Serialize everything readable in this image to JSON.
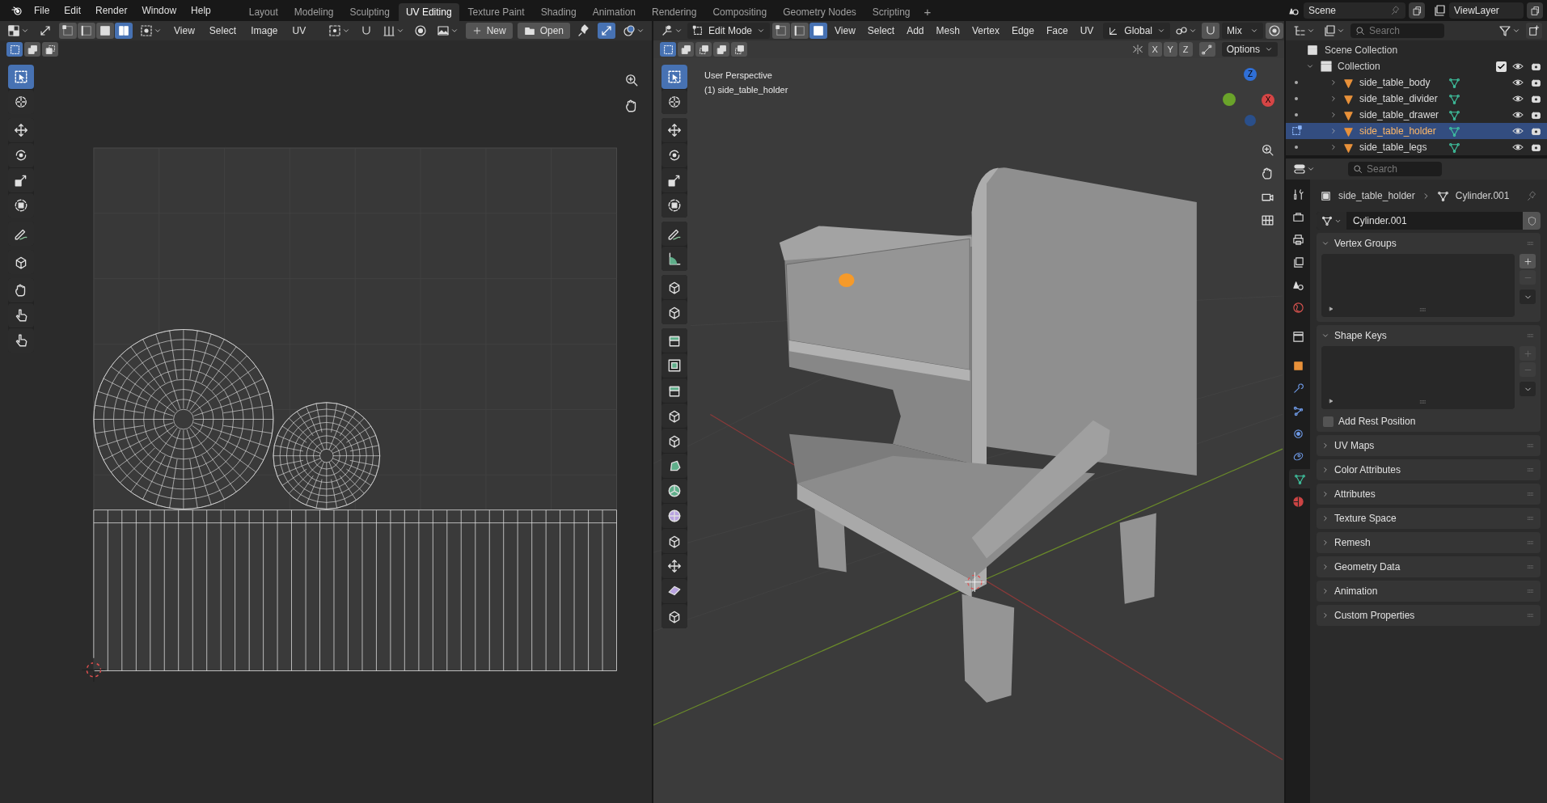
{
  "top_bar": {
    "menus": [
      "File",
      "Edit",
      "Render",
      "Window",
      "Help"
    ],
    "workspaces": [
      {
        "label": "Layout",
        "selected": false
      },
      {
        "label": "Modeling",
        "selected": false
      },
      {
        "label": "Sculpting",
        "selected": false
      },
      {
        "label": "UV Editing",
        "selected": true
      },
      {
        "label": "Texture Paint",
        "selected": false
      },
      {
        "label": "Shading",
        "selected": false
      },
      {
        "label": "Animation",
        "selected": false
      },
      {
        "label": "Rendering",
        "selected": false
      },
      {
        "label": "Compositing",
        "selected": false
      },
      {
        "label": "Geometry Nodes",
        "selected": false
      },
      {
        "label": "Scripting",
        "selected": false
      }
    ],
    "add_tab": "+",
    "scene": "Scene",
    "view_layer": "ViewLayer"
  },
  "uv_editor": {
    "select_modes": [
      {
        "kind": "vertex",
        "selected": false
      },
      {
        "kind": "edge",
        "selected": false
      },
      {
        "kind": "face",
        "selected": false
      },
      {
        "kind": "island",
        "selected": true
      }
    ],
    "menus": [
      "View",
      "Select",
      "Image",
      "UV"
    ],
    "new_button": "New",
    "open_button": "Open"
  },
  "viewport": {
    "mode": "Edit Mode",
    "select_modes": [
      {
        "kind": "vertex",
        "selected": false
      },
      {
        "kind": "edge",
        "selected": false
      },
      {
        "kind": "face",
        "selected": true
      }
    ],
    "menus": [
      "View",
      "Select",
      "Add",
      "Mesh",
      "Vertex",
      "Edge",
      "Face",
      "UV"
    ],
    "orientation": "Global",
    "falloff": "Mix",
    "axes": [
      "X",
      "Y",
      "Z"
    ],
    "options": "Options",
    "overlay_lines": [
      "User Perspective",
      "(1) side_table_holder"
    ],
    "gizmo_labels": [
      "Z",
      "X"
    ]
  },
  "outliner": {
    "search_placeholder": "Search",
    "scene_collection": "Scene Collection",
    "collection": {
      "name": "Collection",
      "expanded": true,
      "checked": true
    },
    "objects": [
      {
        "name": "side_table_body",
        "selected": false
      },
      {
        "name": "side_table_divider",
        "selected": false
      },
      {
        "name": "side_table_drawer",
        "selected": false
      },
      {
        "name": "side_table_holder",
        "selected": true
      },
      {
        "name": "side_table_legs",
        "selected": false
      }
    ]
  },
  "properties": {
    "search_placeholder": "Search",
    "object_name": "side_table_holder",
    "data_name": "Cylinder.001",
    "mesh_field": "Cylinder.001",
    "tabs": [
      {
        "kind": "tool",
        "selected": false
      },
      {
        "kind": "render",
        "selected": false
      },
      {
        "kind": "output",
        "selected": false
      },
      {
        "kind": "view_layer",
        "selected": false
      },
      {
        "kind": "scene",
        "selected": false
      },
      {
        "kind": "world",
        "selected": false
      },
      {
        "kind": "collection",
        "selected": false
      },
      {
        "kind": "object",
        "selected": false
      },
      {
        "kind": "modifiers",
        "selected": false
      },
      {
        "kind": "particles",
        "selected": false
      },
      {
        "kind": "physics",
        "selected": false
      },
      {
        "kind": "constraints",
        "selected": false
      },
      {
        "kind": "data",
        "selected": true
      },
      {
        "kind": "material",
        "selected": false
      }
    ],
    "panels": [
      {
        "title": "Vertex Groups",
        "expanded": true,
        "kind": "list"
      },
      {
        "title": "Shape Keys",
        "expanded": true,
        "kind": "list",
        "checkbox": {
          "label": "Add Rest Position",
          "checked": false
        }
      },
      {
        "title": "UV Maps",
        "expanded": false
      },
      {
        "title": "Color Attributes",
        "expanded": false
      },
      {
        "title": "Attributes",
        "expanded": false
      },
      {
        "title": "Texture Space",
        "expanded": false
      },
      {
        "title": "Remesh",
        "expanded": false
      },
      {
        "title": "Geometry Data",
        "expanded": false
      },
      {
        "title": "Animation",
        "expanded": false
      },
      {
        "title": "Custom Properties",
        "expanded": false
      }
    ]
  }
}
